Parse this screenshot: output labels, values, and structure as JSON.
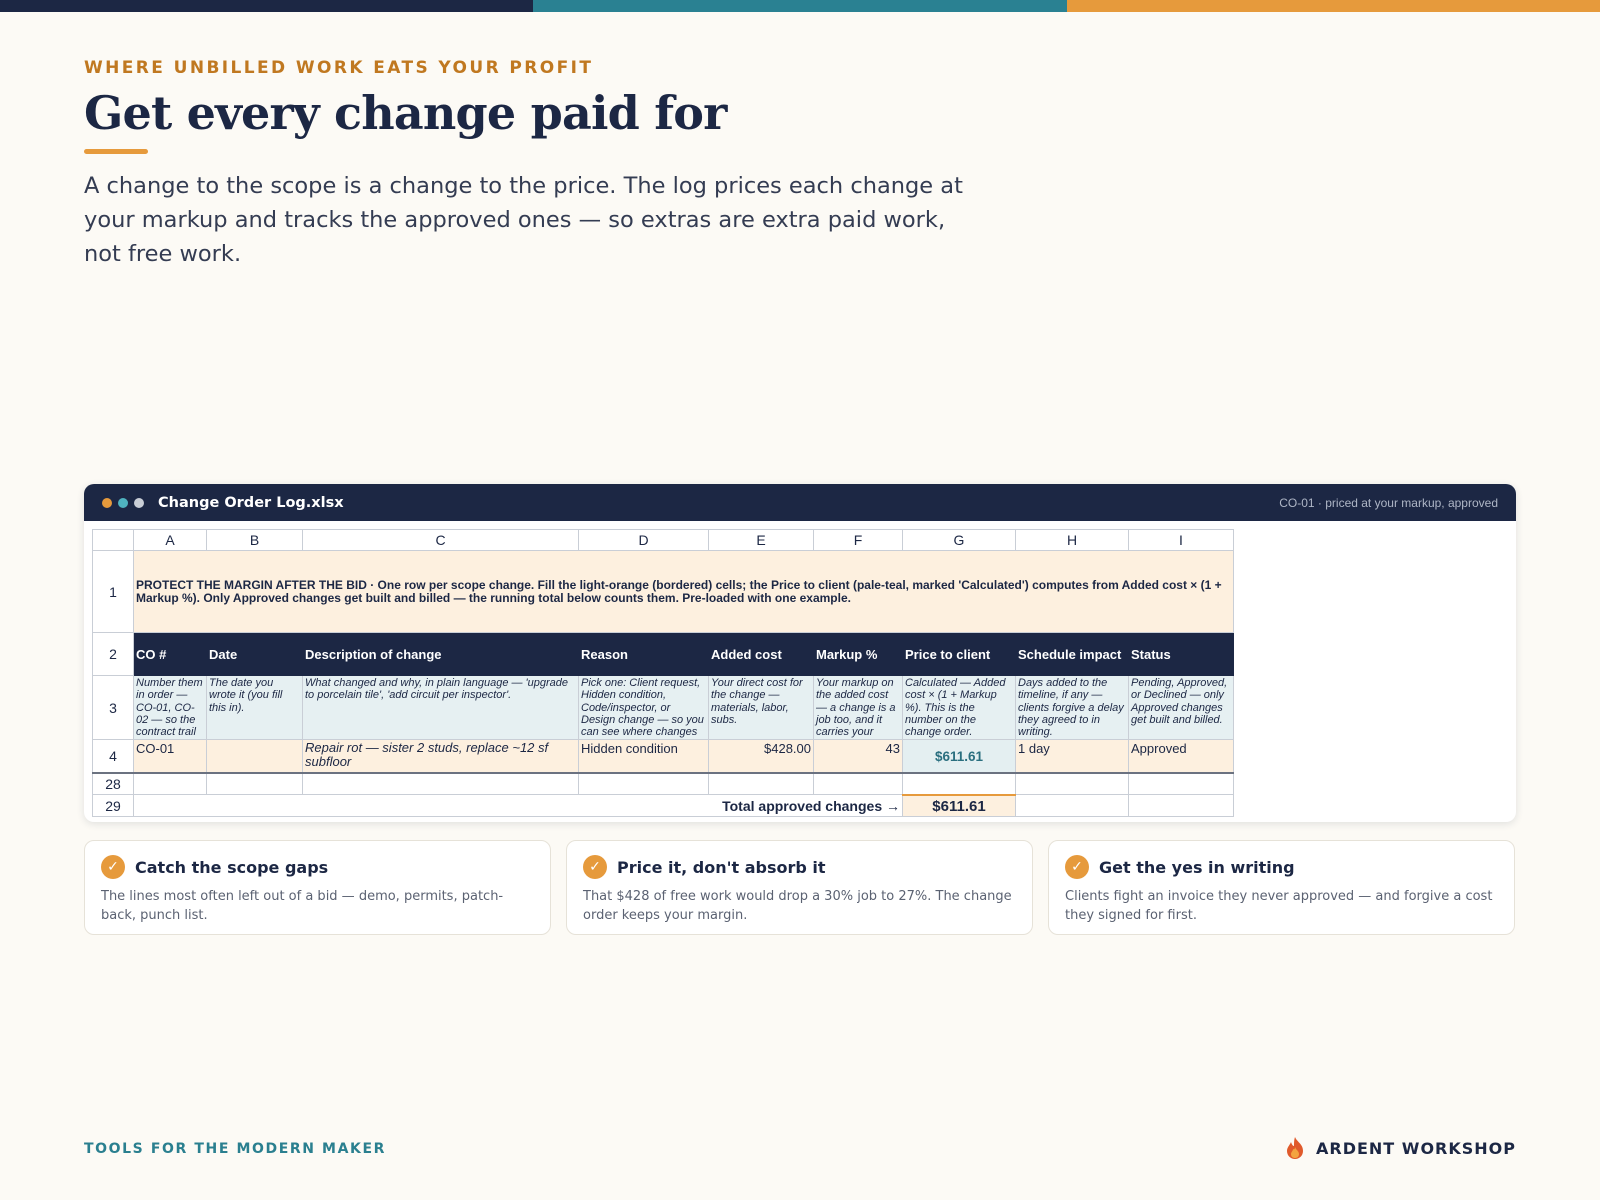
{
  "colors": {
    "navy": "#1c2744",
    "teal": "#2a8192",
    "orange": "#e69a3c",
    "eyebrow": "#c07820",
    "footer_teal": "#2a7f8f"
  },
  "header": {
    "eyebrow": "WHERE UNBILLED WORK EATS YOUR PROFIT",
    "title": "Get every change paid for",
    "lede": "A change to the scope is a change to the price. The log prices each change at your markup and tracks the approved ones — so extras are extra paid work, not free work."
  },
  "window": {
    "filename": "Change Order Log.xlsx",
    "status": "CO-01 · priced at your markup, approved",
    "dots": [
      "#e69a3c",
      "#4fb3c0",
      "#c9ced6"
    ]
  },
  "sheet": {
    "columns": [
      "A",
      "B",
      "C",
      "D",
      "E",
      "F",
      "G",
      "H",
      "I"
    ],
    "row_numbers": [
      "1",
      "2",
      "3",
      "4",
      "28",
      "29"
    ],
    "note": "PROTECT THE MARGIN AFTER THE BID  ·  One row per scope change. Fill the light-orange (bordered) cells; the Price to client (pale-teal, marked 'Calculated') computes from Added cost × (1 + Markup %). Only Approved changes get built and billed — the running total below counts them. Pre-loaded with one example.",
    "headers": [
      "CO #",
      "Date",
      "Description of change",
      "Reason",
      "Added cost",
      "Markup %",
      "Price to client",
      "Schedule impact",
      "Status"
    ],
    "guidance": [
      "Number them in order — CO-01, CO-02 — so the contract trail",
      "The date you wrote it (you fill this in).",
      "What changed and why, in plain language — 'upgrade to porcelain tile', 'add circuit per inspector'.",
      "Pick one: Client request, Hidden condition, Code/inspector, or Design change — so you can see where changes",
      "Your direct cost for the change — materials, labor, subs.",
      "Your markup on the added cost — a change is a job too, and it carries your",
      "Calculated — Added cost × (1 + Markup %). This is the number on the change order.",
      "Days added to the timeline, if any — clients forgive a delay they agreed to in writing.",
      "Pending, Approved, or Declined — only Approved changes get built and billed."
    ],
    "example_row": {
      "co": "CO-01",
      "date": "",
      "description": "Repair rot — sister 2 studs, replace ~12 sf subfloor",
      "reason": "Hidden condition",
      "added_cost": "$428.00",
      "markup": "43",
      "price": "$611.61",
      "schedule": "1 day",
      "status": "Approved"
    },
    "total_label": "Total approved changes →",
    "total_value": "$611.61"
  },
  "cards": [
    {
      "title": "Catch the scope gaps",
      "body": "The lines most often left out of a bid — demo, permits, patch-back, punch list."
    },
    {
      "title": "Price it, don't absorb it",
      "body": "That $428 of free work would drop a 30% job to 27%. The change order keeps your margin."
    },
    {
      "title": "Get the yes in writing",
      "body": "Clients fight an invoice they never approved — and forgive a cost they signed for first."
    }
  ],
  "footer": {
    "tagline": "TOOLS FOR THE MODERN MAKER",
    "brand": "ARDENT WORKSHOP"
  }
}
